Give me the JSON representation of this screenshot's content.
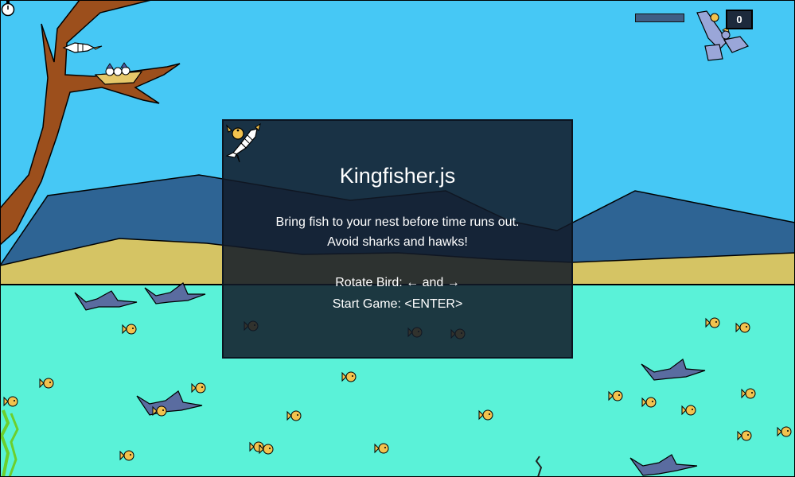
{
  "game": {
    "title": "Kingfisher.js",
    "instructions": {
      "line1": "Bring fish to your nest before time runs out.",
      "line2": "Avoid sharks and hawks!",
      "line3": "Rotate Bird: ← and →",
      "line4": "Start Game: <ENTER>"
    }
  },
  "hud": {
    "score": "0",
    "timer_fraction": 1.0,
    "timer_icon": "stopwatch-icon",
    "hawk_icon": "hawk-icon"
  },
  "colors": {
    "sky": "#46c8f5",
    "mountains": "#2e6494",
    "sand": "#d5c464",
    "water": "#5af2d8",
    "tree": "#9c4f1c",
    "fish": "#f2c24e",
    "shark": "#5a6ca0",
    "panel": "#121a28"
  }
}
